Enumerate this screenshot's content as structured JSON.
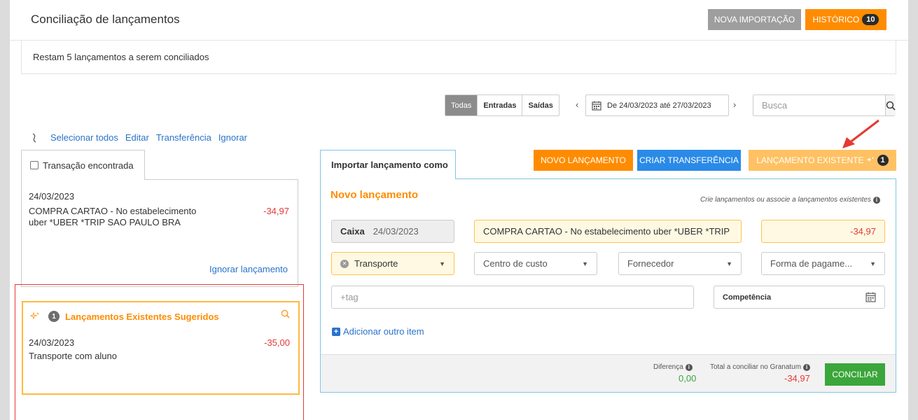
{
  "header": {
    "title": "Conciliação de lançamentos",
    "new_import_label": "NOVA IMPORTAÇÃO",
    "history_label": "HISTÓRICO",
    "history_count": "10"
  },
  "notice": "Restam 5 lançamentos a serem conciliados",
  "filters": {
    "segments": [
      "Todas",
      "Entradas",
      "Saídas"
    ],
    "active_segment": "Todas",
    "date_range": "De 24/03/2023 até 27/03/2023",
    "search_placeholder": "Busca"
  },
  "actions": {
    "select_all": "Selecionar todos",
    "edit": "Editar",
    "transfer": "Transferência",
    "ignore": "Ignorar"
  },
  "left_panel": {
    "tab_label": "Transação encontrada",
    "transaction": {
      "date": "24/03/2023",
      "description": "COMPRA CARTAO - No estabelecimento uber *UBER *TRIP SAO PAULO BRA",
      "amount": "-34,97"
    },
    "ignore_link": "Ignorar lançamento",
    "suggestions": {
      "count": "1",
      "title": "Lançamentos Existentes Sugeridos",
      "item": {
        "date": "24/03/2023",
        "description": "Transporte com aluno",
        "amount": "-35,00"
      }
    }
  },
  "right_panel": {
    "tab_label": "Importar lançamento como",
    "buttons": {
      "new_entry": "NOVO LANÇAMENTO",
      "create_transfer": "CRIAR TRANSFERÊNCIA",
      "existing_entry": "LANÇAMENTO EXISTENTE",
      "existing_count": "1"
    },
    "heading": "Novo lançamento",
    "hint": "Crie lançamentos ou associe a lançamentos existentes",
    "form": {
      "account": "Caixa",
      "date": "24/03/2023",
      "description": "COMPRA CARTAO - No estabelecimento uber *UBER *TRIP SAO PAULO BRA",
      "amount": "-34,97",
      "category": "Transporte",
      "cost_center_placeholder": "Centro de custo",
      "supplier_placeholder": "Fornecedor",
      "payment_placeholder": "Forma de pagame...",
      "tag_placeholder": "+tag",
      "competence_label": "Competência"
    },
    "add_item": "Adicionar outro item",
    "footer": {
      "difference_label": "Diferença",
      "difference_value": "0,00",
      "total_label": "Total a conciliar no Granatum",
      "total_value": "-34,97",
      "reconcile_label": "CONCILIAR"
    }
  },
  "colors": {
    "accent_orange": "#ff8c00",
    "blue": "#2a8ae8",
    "negative": "#e53935",
    "positive": "#3ba63b",
    "annotation_red": "#e53935"
  }
}
